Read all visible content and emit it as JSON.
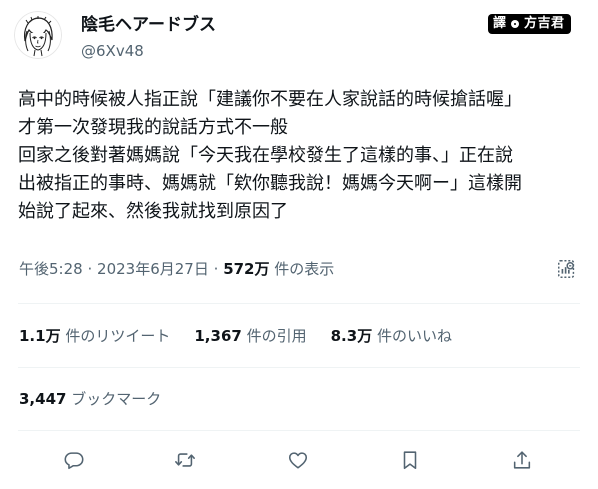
{
  "header": {
    "display_name": "陰毛ヘアードブス",
    "handle": "@6Xv48",
    "avatar": "avatar-illustration"
  },
  "watermark": {
    "icon_text": "譯",
    "text": "方吉君"
  },
  "tweet": {
    "lines": [
      "高中的時候被人指正說「建議你不要在人家說話的時候搶話喔」",
      "才第一次發現我的說話方式不一般",
      "回家之後對著媽媽說「今天我在學校發生了這樣的事、」正在說",
      "出被指正的事時、媽媽就「欸你聽我說！媽媽今天啊ー」這樣開",
      "始說了起來、然後我就找到原因了"
    ]
  },
  "meta": {
    "time": "午後5:28",
    "separator": "·",
    "date": "2023年6月27日",
    "separator2": "·",
    "views_count": "572万",
    "views_label": "件の表示"
  },
  "stats": {
    "retweets": {
      "count": "1.1万",
      "label": "件のリツイート"
    },
    "quotes": {
      "count": "1,367",
      "label": "件の引用"
    },
    "likes": {
      "count": "8.3万",
      "label": "件のいいね"
    },
    "bookmarks": {
      "count": "3,447",
      "label": "ブックマーク"
    }
  },
  "icons": {
    "reply": "reply-icon",
    "retweet": "retweet-icon",
    "like": "heart-icon",
    "bookmark": "bookmark-icon",
    "share": "share-icon",
    "analytics": "analytics-icon"
  },
  "colors": {
    "text_primary": "#0f1419",
    "text_secondary": "#536471",
    "divider": "#eff3f4",
    "icon": "#536471"
  }
}
